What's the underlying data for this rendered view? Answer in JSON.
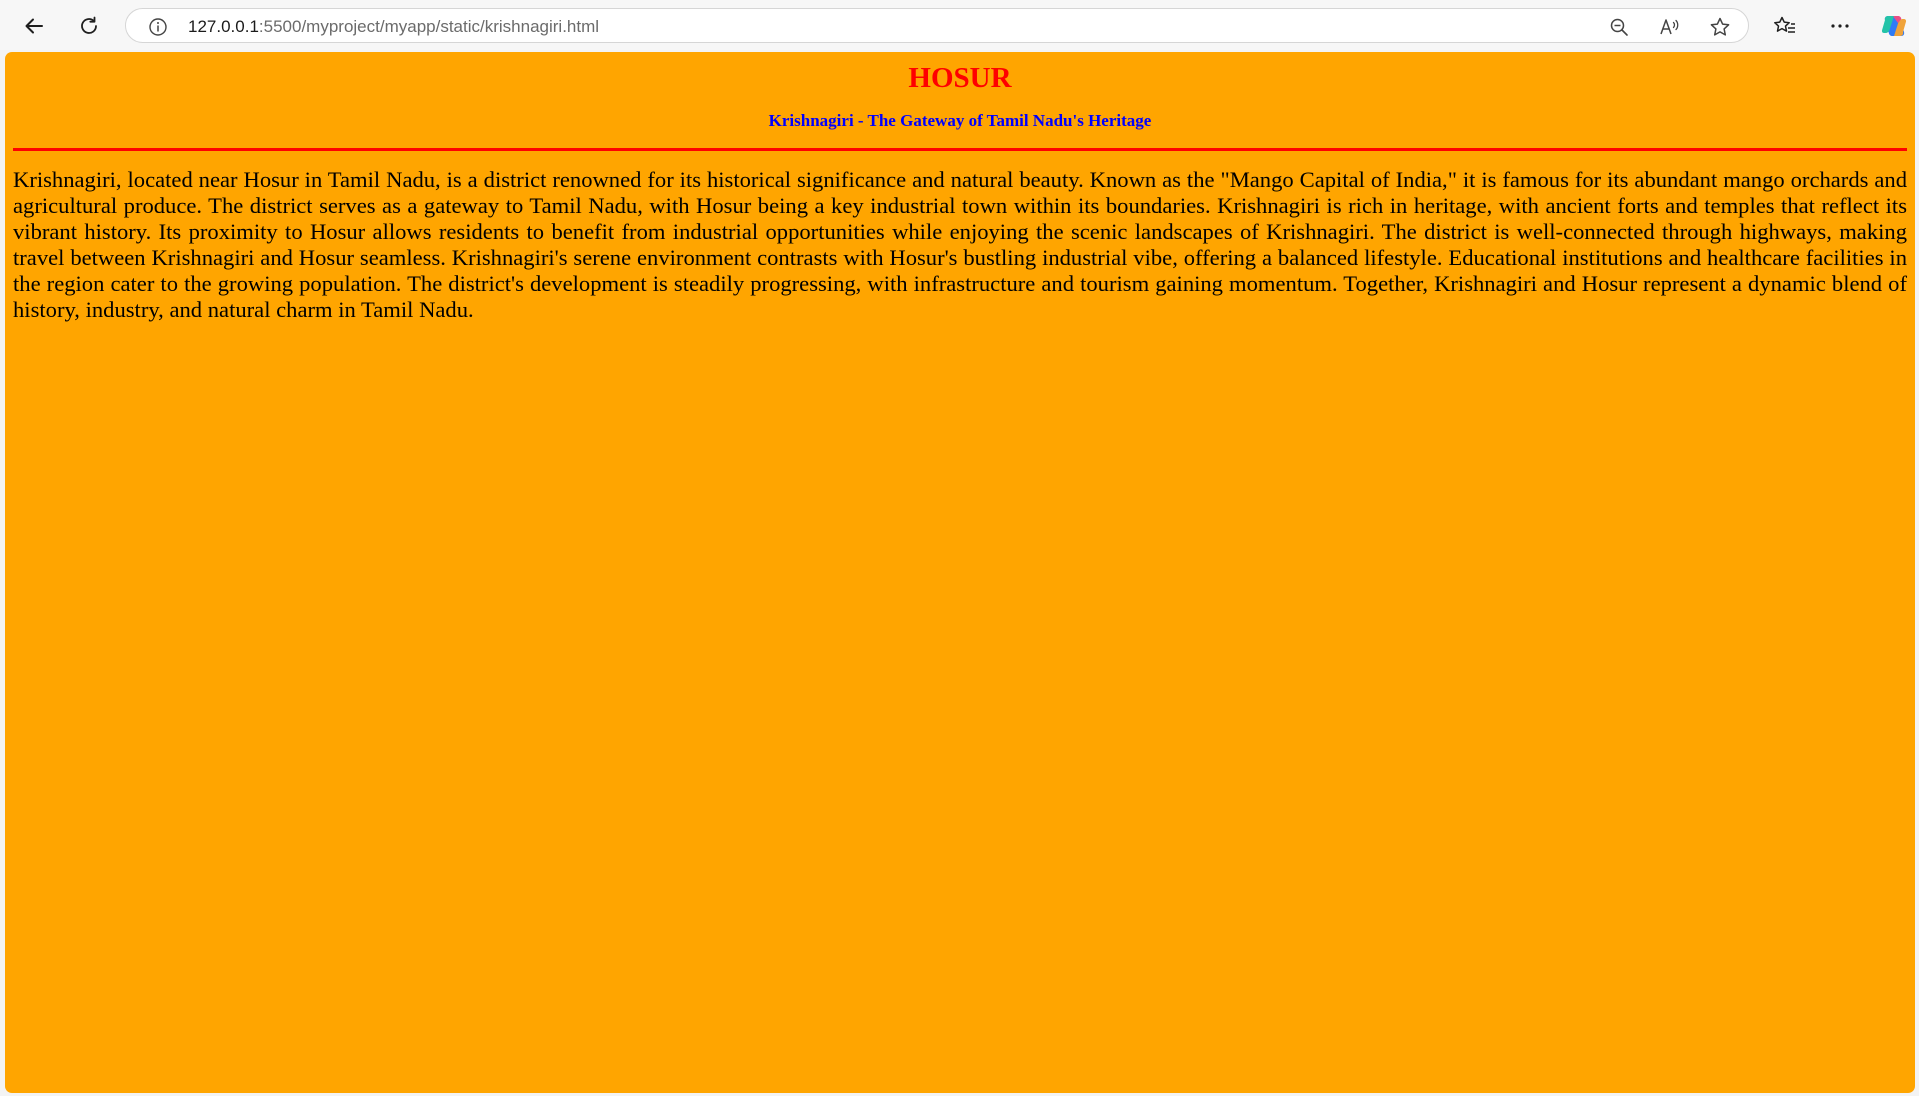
{
  "browser": {
    "url_host": "127.0.0.1",
    "url_rest": ":5500/myproject/myapp/static/krishnagiri.html",
    "icons": {
      "back": "back-arrow-icon",
      "refresh": "refresh-icon",
      "site_info": "info-icon",
      "zoom": "zoom-out-icon",
      "read_aloud": "read-aloud-icon",
      "favorite": "star-icon",
      "favorites_list": "favorites-icon",
      "more": "more-icon",
      "copilot": "copilot-icon"
    }
  },
  "page": {
    "title": "HOSUR",
    "subtitle": "Krishnagiri - The Gateway of Tamil Nadu's Heritage",
    "body": "Krishnagiri, located near Hosur in Tamil Nadu, is a district renowned for its historical significance and natural beauty. Known as the \"Mango Capital of India,\" it is famous for its abundant mango orchards and agricultural produce. The district serves as a gateway to Tamil Nadu, with Hosur being a key industrial town within its boundaries. Krishnagiri is rich in heritage, with ancient forts and temples that reflect its vibrant history. Its proximity to Hosur allows residents to benefit from industrial opportunities while enjoying the scenic landscapes of Krishnagiri. The district is well-connected through highways, making travel between Krishnagiri and Hosur seamless. Krishnagiri's serene environment contrasts with Hosur's bustling industrial vibe, offering a balanced lifestyle. Educational institutions and healthcare facilities in the region cater to the growing population. The district's development is steadily progressing, with infrastructure and tourism gaining momentum. Together, Krishnagiri and Hosur represent a dynamic blend of history, industry, and natural charm in Tamil Nadu.",
    "colors": {
      "background": "#ffa500",
      "title": "#ff0000",
      "subtitle": "#0000ff",
      "divider": "#ff0000",
      "body_text": "#000000"
    }
  }
}
